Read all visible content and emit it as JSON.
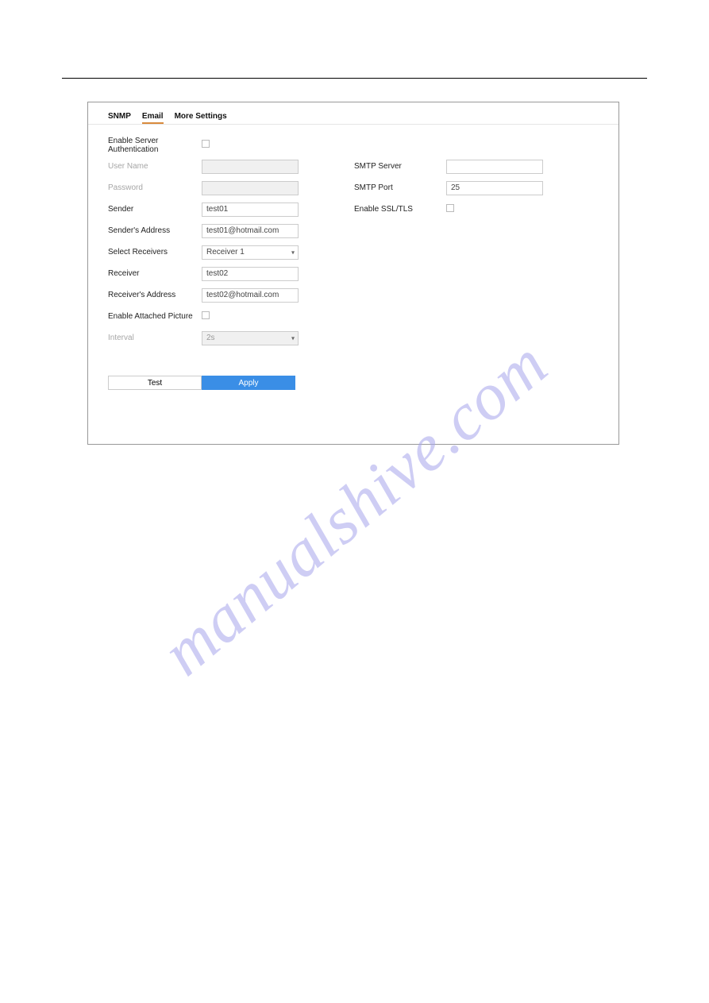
{
  "tabs": {
    "snmp": "SNMP",
    "email": "Email",
    "more": "More Settings"
  },
  "labels": {
    "enable_auth": "Enable Server Authentication",
    "username": "User Name",
    "password": "Password",
    "sender": "Sender",
    "sender_addr": "Sender's Address",
    "select_receivers": "Select Receivers",
    "receiver": "Receiver",
    "receiver_addr": "Receiver's Address",
    "enable_attached": "Enable Attached Picture",
    "interval": "Interval",
    "smtp_server": "SMTP Server",
    "smtp_port": "SMTP Port",
    "enable_ssl": "Enable SSL/TLS"
  },
  "values": {
    "username": "",
    "password": "",
    "sender": "test01",
    "sender_addr": "test01@hotmail.com",
    "select_receivers": "Receiver 1",
    "receiver": "test02",
    "receiver_addr": "test02@hotmail.com",
    "interval": "2s",
    "smtp_server": "",
    "smtp_port": "25"
  },
  "buttons": {
    "test": "Test",
    "apply": "Apply"
  },
  "watermark": "manualshive.com"
}
